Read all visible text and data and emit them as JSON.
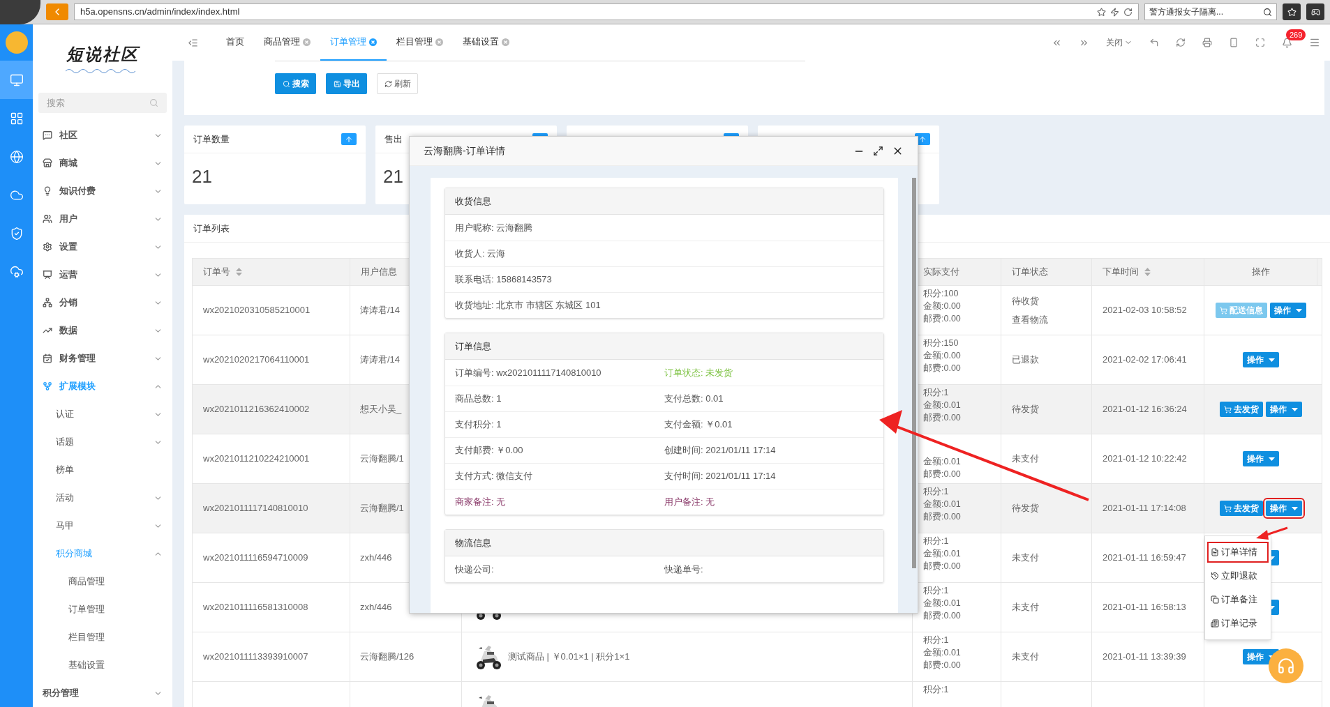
{
  "browser": {
    "url": "h5a.opensns.cn/admin/index/index.html",
    "search": "警方通报女子隔离..."
  },
  "rail": [
    {
      "selected": true
    },
    {
      "selected": false
    },
    {
      "selected": false
    },
    {
      "selected": false
    },
    {
      "selected": false
    },
    {
      "selected": false
    }
  ],
  "logo": {
    "text": "短说社区"
  },
  "sidebar": {
    "search_placeholder": "搜索",
    "items": [
      {
        "label": "社区",
        "expanded": false,
        "kind": "group"
      },
      {
        "label": "商城",
        "expanded": false,
        "kind": "group"
      },
      {
        "label": "知识付费",
        "expanded": false,
        "kind": "group"
      },
      {
        "label": "用户",
        "expanded": false,
        "kind": "group"
      },
      {
        "label": "设置",
        "expanded": false,
        "kind": "group"
      },
      {
        "label": "运营",
        "expanded": false,
        "kind": "group"
      },
      {
        "label": "分销",
        "expanded": false,
        "kind": "group"
      },
      {
        "label": "数据",
        "expanded": false,
        "kind": "group"
      },
      {
        "label": "财务管理",
        "expanded": false,
        "kind": "group"
      },
      {
        "label": "扩展模块",
        "expanded": true,
        "kind": "group",
        "children": [
          {
            "label": "认证",
            "expanded": false,
            "kind": "group"
          },
          {
            "label": "话题",
            "expanded": false,
            "kind": "group"
          },
          {
            "label": "榜单",
            "kind": "link"
          },
          {
            "label": "活动",
            "expanded": false,
            "kind": "group"
          },
          {
            "label": "马甲",
            "expanded": false,
            "kind": "group"
          },
          {
            "label": "积分商城",
            "expanded": true,
            "kind": "group",
            "children": [
              {
                "label": "商品管理",
                "kind": "link"
              },
              {
                "label": "订单管理",
                "kind": "link"
              },
              {
                "label": "栏目管理",
                "kind": "link"
              },
              {
                "label": "基础设置",
                "kind": "link"
              }
            ]
          }
        ]
      },
      {
        "label": "积分管理",
        "expanded": false,
        "kind": "group"
      }
    ]
  },
  "tabs": [
    {
      "label": "首页",
      "closable": false,
      "selected": false
    },
    {
      "label": "商品管理",
      "closable": true,
      "selected": false
    },
    {
      "label": "订单管理",
      "closable": true,
      "selected": true
    },
    {
      "label": "栏目管理",
      "closable": true,
      "selected": false
    },
    {
      "label": "基础设置",
      "closable": true,
      "selected": false
    }
  ],
  "toolbar": {
    "close_label": "关闭",
    "notifications": "269"
  },
  "filter": {
    "buttons": [
      {
        "label": "搜索",
        "kind": "primary"
      },
      {
        "label": "导出",
        "kind": "primary"
      },
      {
        "label": "刷新",
        "kind": "default"
      }
    ]
  },
  "stats": [
    {
      "kind": "stat",
      "label": "订单数量",
      "value": "21"
    },
    {
      "kind": "stat",
      "label": "售出",
      "value": "21"
    },
    {
      "kind": "stat"
    },
    {
      "kind": "stat"
    }
  ],
  "table": {
    "title": "订单列表",
    "columns": [
      {
        "kind": "text",
        "label": "订单号",
        "sortable": true
      },
      {
        "kind": "text",
        "label": "用户信息"
      },
      {
        "kind": "blank"
      },
      {
        "kind": "text",
        "label": "实际支付"
      },
      {
        "kind": "text",
        "label": "订单状态"
      },
      {
        "kind": "text",
        "label": "下单时间",
        "sortable": true
      },
      {
        "kind": "text",
        "label": "操作"
      }
    ],
    "rows": [
      {
        "shaded": false,
        "order_no": "wx2021020310585210001",
        "user": "涛涛君/14",
        "payment": [
          "积分:100",
          "金额:0.00",
          "邮费:0.00"
        ],
        "status": [
          "待收货",
          "查看物流"
        ],
        "time": "2021-02-03 10:58:52",
        "actions": [
          {
            "kind": "info",
            "label": "配送信息"
          },
          {
            "kind": "menu",
            "label": "操作"
          }
        ]
      },
      {
        "shaded": false,
        "order_no": "wx2021020217064110001",
        "user": "涛涛君/14",
        "payment": [
          "积分:150",
          "金额:0.00",
          "邮费:0.00"
        ],
        "status": [
          "已退款"
        ],
        "time": "2021-02-02 17:06:41",
        "actions": [
          {
            "kind": "menu",
            "label": "操作"
          }
        ]
      },
      {
        "shaded": true,
        "order_no": "wx2021011216362410002",
        "user": "想天小吴_",
        "payment": [
          "积分:1",
          "金额:0.01",
          "邮费:0.00"
        ],
        "status": [
          "待发货"
        ],
        "time": "2021-01-12 16:36:24",
        "actions": [
          {
            "kind": "ship",
            "label": "去发货"
          },
          {
            "kind": "menu",
            "label": "操作"
          }
        ]
      },
      {
        "shaded": false,
        "order_no": "wx2021011210224210001",
        "user": "云海翻腾/1",
        "payment": [
          "金额:0.01",
          "邮费:0.00"
        ],
        "status": [
          "未支付"
        ],
        "time": "2021-01-12 10:22:42",
        "actions": [
          {
            "kind": "menu",
            "label": "操作"
          }
        ]
      },
      {
        "shaded": true,
        "order_no": "wx2021011117140810010",
        "user": "云海翻腾/1",
        "payment": [
          "积分:1",
          "金额:0.01",
          "邮费:0.00"
        ],
        "status": [
          "待发货"
        ],
        "time": "2021-01-11 17:14:08",
        "actions": [
          {
            "kind": "ship",
            "label": "去发货"
          },
          {
            "kind": "menu",
            "label": "操作",
            "highlighted": true
          }
        ]
      },
      {
        "shaded": false,
        "order_no": "wx2021011116594710009",
        "user": "zxh/446",
        "payment": [
          "积分:1",
          "金额:0.01",
          "邮费:0.00"
        ],
        "status": [
          "未支付"
        ],
        "time": "2021-01-11 16:59:47",
        "actions": [
          {
            "kind": "menu"
          }
        ]
      },
      {
        "shaded": false,
        "order_no": "wx2021011116581310008",
        "user": "zxh/446",
        "product": {
          "kind": "picture"
        },
        "payment": [
          "积分:1",
          "金额:0.01",
          "邮费:0.00"
        ],
        "status": [
          "未支付"
        ],
        "time": "2021-01-11 16:58:13",
        "actions": [
          {
            "kind": "menu"
          }
        ]
      },
      {
        "shaded": false,
        "order_no": "wx2021011113393910007",
        "user": "云海翻腾/126",
        "product": {
          "kind": "picture",
          "text": "测试商品 | ￥0.01×1 | 积分1×1"
        },
        "payment": [
          "积分:1",
          "金额:0.01",
          "邮费:0.00"
        ],
        "status": [
          "未支付"
        ],
        "time": "2021-01-11 13:39:39",
        "actions": [
          {
            "kind": "menu",
            "label": "操作"
          }
        ]
      },
      {
        "shaded": false,
        "product": {
          "kind": "picture"
        },
        "payment": [
          "积分:1"
        ]
      }
    ]
  },
  "menu": {
    "items": [
      {
        "label": "订单详情",
        "highlighted": true
      },
      {
        "label": "立即退款",
        "highlighted": false
      },
      {
        "label": "订单备注",
        "highlighted": false
      },
      {
        "label": "订单记录",
        "highlighted": false
      }
    ]
  },
  "modal": {
    "title": "云海翻腾-订单详情",
    "sections": [
      {
        "title": "收货信息",
        "rows": [
          [
            {
              "text": "用户昵称: 云海翻腾"
            }
          ],
          [
            {
              "text": "收货人: 云海"
            }
          ],
          [
            {
              "text": "联系电话: 15868143573"
            }
          ],
          [
            {
              "text": "收货地址: 北京市 市辖区 东城区 101"
            }
          ]
        ]
      },
      {
        "title": "订单信息",
        "rows": [
          [
            {
              "text": "订单编号: wx2021011117140810010"
            },
            {
              "text": "订单状态: 未发货",
              "color": "#7dc242"
            }
          ],
          [
            {
              "text": "商品总数: 1"
            },
            {
              "text": "支付总数: 0.01"
            }
          ],
          [
            {
              "text": "支付积分: 1"
            },
            {
              "text": "支付金额: ￥0.01"
            }
          ],
          [
            {
              "text": "支付邮费: ￥0.00"
            },
            {
              "text": "创建时间: 2021/01/11 17:14"
            }
          ],
          [
            {
              "text": "支付方式: 微信支付"
            },
            {
              "text": "支付时间: 2021/01/11 17:14"
            }
          ],
          [
            {
              "text": "商家备注: 无",
              "color": "#8a3a6a"
            },
            {
              "text": "用户备注: 无",
              "color": "#8a3a6a"
            }
          ]
        ]
      },
      {
        "title": "物流信息",
        "rows": [
          [
            {
              "text": "快递公司:"
            },
            {
              "text": "快递单号:"
            }
          ]
        ]
      }
    ]
  }
}
